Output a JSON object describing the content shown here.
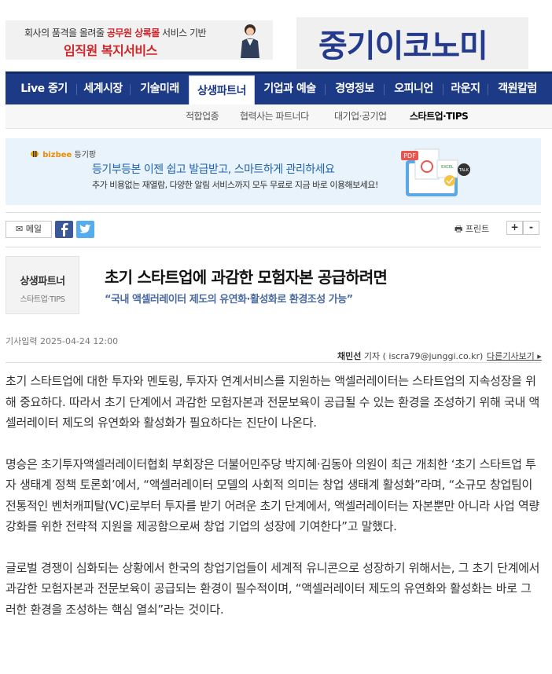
{
  "ad_top": {
    "line1_pre": "회사의 품격을 올려줄 ",
    "line1_red": "공무원 상록몰",
    "line1_post": " 서비스 기반",
    "line2": "임직원 복지서비스"
  },
  "logo": "중기이코노미",
  "nav": {
    "items": [
      "Live 중기",
      "세계시장",
      "기술미래",
      "상생파트너",
      "기업과 예술",
      "경영정보",
      "오피니언",
      "라운지",
      "객원칼럼"
    ],
    "active": "상생파트너"
  },
  "subnav": {
    "items": [
      "적합업종",
      "협력사는 파트너다",
      "대기업·공기업",
      "스타트업·TIPS"
    ],
    "active": "스타트업·TIPS"
  },
  "ad_mid": {
    "brand": "bizbee",
    "brand_sub": "등기팡",
    "line1": "등기부등본 이젠 쉽고 발급받고, 스마트하게 관리하세요",
    "line2": "추가 비용없는 재열람, 다양한 알림 서비스까지 모두 무료로 지금 바로 이용해보세요!"
  },
  "tools": {
    "mail": "메일",
    "print": "프린트",
    "zoom_in": "+",
    "zoom_out": "-"
  },
  "article": {
    "section": "상생파트너",
    "subsection": "스타트업·TIPS",
    "title": "초기 스타트업에 과감한 모험자본 공급하려면",
    "subtitle": "“국내 액셀러레이터 제도의 유연화·활성화로 환경조성 가능”",
    "date": "기사입력 2025-04-24 12:00",
    "reporter": "채민선",
    "reporter_suffix": " 기자 ( iscra79@junggi.co.kr)",
    "more_articles": "다른기사보기",
    "paragraphs": [
      "초기 스타트업에 대한 투자와 멘토링, 투자자 연계서비스를 지원하는 액셀러레이터는 스타트업의 지속성장을 위해 중요하다. 따라서 초기 단계에서 과감한 모험자본과 전문보육이 공급될 수 있는 환경을 조성하기 위해 국내 액셀러레이터 제도의 유연화와 활성화가 필요하다는 진단이 나온다.",
      "명승은 초기투자액셀러레이터협회 부회장은 더불어민주당 박지혜·김동아 의원이 최근 개최한 ‘초기 스타트업 투자 생태계 정책 토론회’에서, “액셀러레이터 모델의 사회적 의미는 창업 생태계 활성화”라며, “소규모 창업팀이 전통적인 벤처캐피탈(VC)로부터 투자를 받기 어려운 초기 단계에서, 액셀러레이터는 자본뿐만 아니라 사업 역량강화를 위한 전략적 지원을 제공함으로써 창업 기업의 성장에 기여한다”고 말했다.",
      "글로벌 경쟁이 심화되는 상황에서 한국의 창업기업들이 세계적 유니콘으로 성장하기 위해서는, 그 초기 단계에서 과감한 모험자본과 전문보육이 공급되는 환경이 필수적이며, “액셀러레이터 제도의 유연화와 활성화는 바로 그러한 환경을 조성하는 핵심 열쇠”라는 것이다."
    ]
  }
}
